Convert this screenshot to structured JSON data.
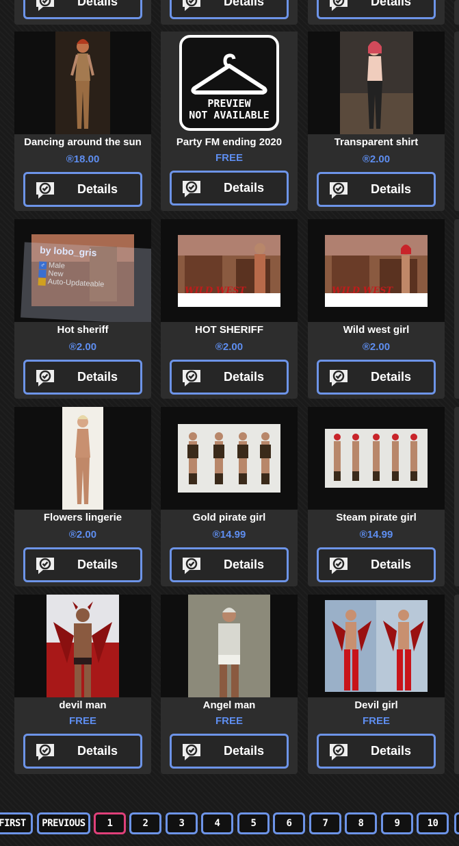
{
  "details_label": "Details",
  "top_row": [
    {
      "button": "Details"
    },
    {
      "button": "Details"
    },
    {
      "button": "Details"
    }
  ],
  "products": [
    {
      "title": "Dancing around the sun",
      "price": "®18.00"
    },
    {
      "title": "Party FM ending 2020",
      "price": "FREE",
      "placeholder_line1": "PREVIEW",
      "placeholder_line2": "NOT AVAILABLE"
    },
    {
      "title": "Transparent shirt",
      "price": "®2.00"
    },
    {
      "title": "Hot sheriff",
      "price": "®2.00",
      "overlay": {
        "author": "by lobo_gris",
        "tag1": "Male",
        "tag2": "New",
        "tag3": "Auto-Updateable"
      }
    },
    {
      "title": "HOT SHERIFF",
      "price": "®2.00",
      "banner": "WILD WEST"
    },
    {
      "title": "Wild west girl",
      "price": "®2.00",
      "banner": "WILD WEST"
    },
    {
      "title": "Flowers lingerie",
      "price": "®2.00"
    },
    {
      "title": "Gold pirate girl",
      "price": "®14.99"
    },
    {
      "title": "Steam pirate girl",
      "price": "®14.99"
    },
    {
      "title": "devil man",
      "price": "FREE"
    },
    {
      "title": "Angel man",
      "price": "FREE"
    },
    {
      "title": "Devil girl",
      "price": "FREE"
    }
  ],
  "pagination": {
    "first": "FIRST",
    "previous": "PREVIOUS",
    "pages": [
      "1",
      "2",
      "3",
      "4",
      "5",
      "6",
      "7",
      "8",
      "9",
      "10"
    ],
    "current": "1"
  },
  "colors": {
    "accent": "#6d94e8",
    "price": "#5e8ef0",
    "active_page": "#e0407a",
    "card": "#2d2d2d"
  }
}
